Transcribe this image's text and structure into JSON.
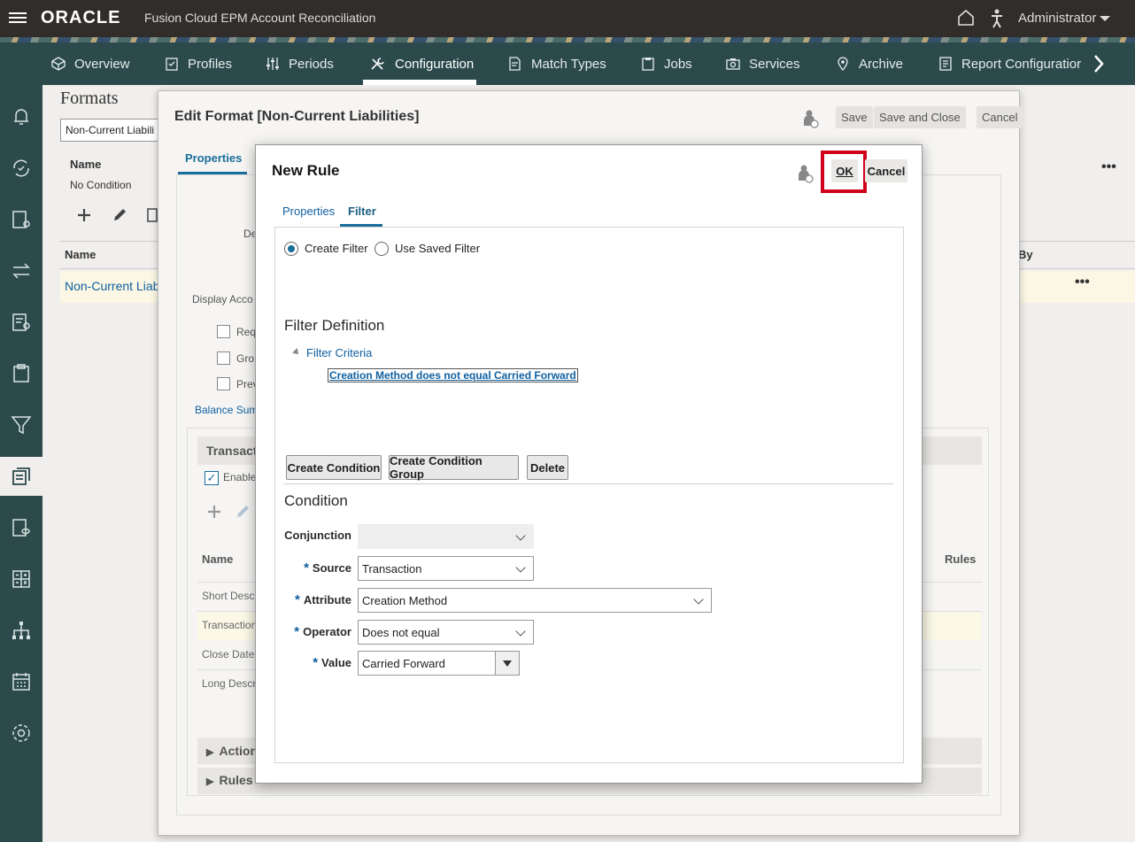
{
  "header": {
    "brand": "ORACLE",
    "app_title": "Fusion Cloud EPM Account Reconciliation",
    "user": "Administrator"
  },
  "nav": {
    "items": [
      {
        "label": "Overview"
      },
      {
        "label": "Profiles"
      },
      {
        "label": "Periods"
      },
      {
        "label": "Configuration"
      },
      {
        "label": "Match Types"
      },
      {
        "label": "Jobs"
      },
      {
        "label": "Services"
      },
      {
        "label": "Archive"
      },
      {
        "label": "Report Configuratior"
      }
    ],
    "active": "Configuration"
  },
  "background": {
    "page_title": "Formats",
    "search_value": "Non-Current Liabili",
    "name_header": "Name",
    "no_condition": "No Condition",
    "name_header2": "Name",
    "row_link": "Non-Current Liab",
    "by_header": "By"
  },
  "edit_dialog": {
    "title": "Edit Format [Non-Current Liabilities]",
    "save": "Save",
    "save_close": "Save and Close",
    "cancel": "Cancel",
    "tab_properties": "Properties",
    "frag_de": "De",
    "frag_display": "Display Acco",
    "frag_req": "Req",
    "frag_gro": "Gro",
    "frag_prev": "Prev",
    "frag_balance": "Balance Sum",
    "frag_transact": "Transact",
    "frag_enable": "Enable",
    "frag_name": "Name",
    "frag_short": "Short Desc",
    "frag_transaction": "Transaction",
    "frag_close": "Close Date",
    "frag_long": "Long Descr",
    "frag_action": "Action",
    "frag_rules": "Rules",
    "frag_rules_col": "Rules"
  },
  "modal": {
    "title": "New Rule",
    "ok": "OK",
    "cancel": "Cancel",
    "tabs": [
      "Properties",
      "Filter"
    ],
    "active_tab": "Filter",
    "radio_create": "Create Filter",
    "radio_saved": "Use Saved Filter",
    "filter_definition": "Filter Definition",
    "filter_criteria": "Filter Criteria",
    "criteria_item": "Creation Method does not equal Carried Forward",
    "buttons": {
      "create_condition": "Create Condition",
      "create_group": "Create Condition Group",
      "delete": "Delete"
    },
    "condition_heading": "Condition",
    "fields": {
      "conjunction_label": "Conjunction",
      "conjunction_value": "",
      "source_label": "Source",
      "source_value": "Transaction",
      "attribute_label": "Attribute",
      "attribute_value": "Creation Method",
      "operator_label": "Operator",
      "operator_value": "Does not equal",
      "value_label": "Value",
      "value_value": "Carried Forward"
    },
    "required_marker": "*"
  },
  "colors": {
    "topbar": "#312d2a",
    "navbar": "#2c4a4c",
    "link": "#1060a0",
    "highlight_frame": "#d0021b"
  }
}
